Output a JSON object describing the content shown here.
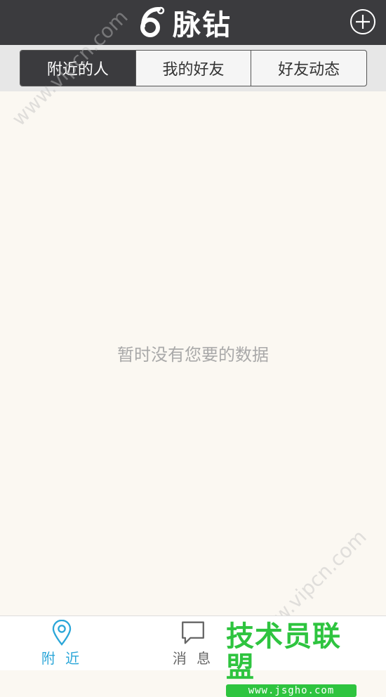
{
  "header": {
    "title": "脉钻",
    "logo_icon": "six-logo-icon",
    "add_icon": "plus-circle-icon"
  },
  "segments": [
    {
      "label": "附近的人",
      "active": true
    },
    {
      "label": "我的好友",
      "active": false
    },
    {
      "label": "好友动态",
      "active": false
    }
  ],
  "content": {
    "empty_message": "暂时没有您要的数据"
  },
  "watermark": {
    "text": "www.vipcn.com"
  },
  "tabbar": {
    "items": [
      {
        "label": "附 近",
        "icon": "location-pin-icon",
        "active": true
      },
      {
        "label": "消 息",
        "icon": "chat-bubble-icon",
        "active": false
      }
    ]
  },
  "brand": {
    "main": "技术员联盟",
    "sub": "www.jsgho.com"
  },
  "colors": {
    "header_bg": "#3b3b3e",
    "accent": "#2aa6d8",
    "brand_green": "#2ec43f",
    "content_bg": "#fbf8f2"
  }
}
